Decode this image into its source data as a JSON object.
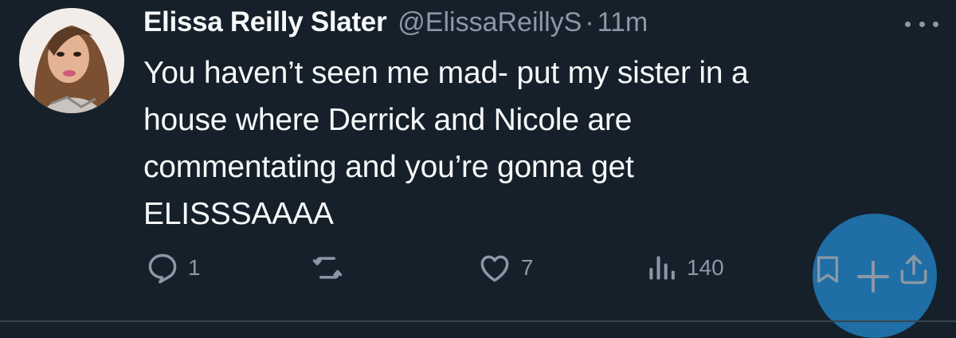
{
  "tweet": {
    "display_name": "Elissa Reilly Slater",
    "handle": "@ElissaReillyS",
    "separator": "·",
    "time": "11m",
    "text": "You haven’t seen me mad- put my sister in a\nhouse where Derrick and Nicole are\ncommentating and you’re gonna get\nELISSSAAAA",
    "avatar_icon": "profile-photo",
    "more_icon": "ellipsis-icon"
  },
  "actions": {
    "reply": {
      "icon": "reply-icon",
      "count": "1"
    },
    "retweet": {
      "icon": "retweet-icon",
      "count": ""
    },
    "like": {
      "icon": "heart-icon",
      "count": "7"
    },
    "views": {
      "icon": "views-chart-icon",
      "count": "140"
    },
    "bookmark": {
      "icon": "bookmark-icon"
    },
    "share": {
      "icon": "share-icon"
    }
  },
  "compose_button": {
    "icon": "plus-icon"
  },
  "colors": {
    "background": "#15202b",
    "text": "#f7f9f9",
    "muted": "#8b98a5",
    "fab": "#1f6ea5"
  }
}
